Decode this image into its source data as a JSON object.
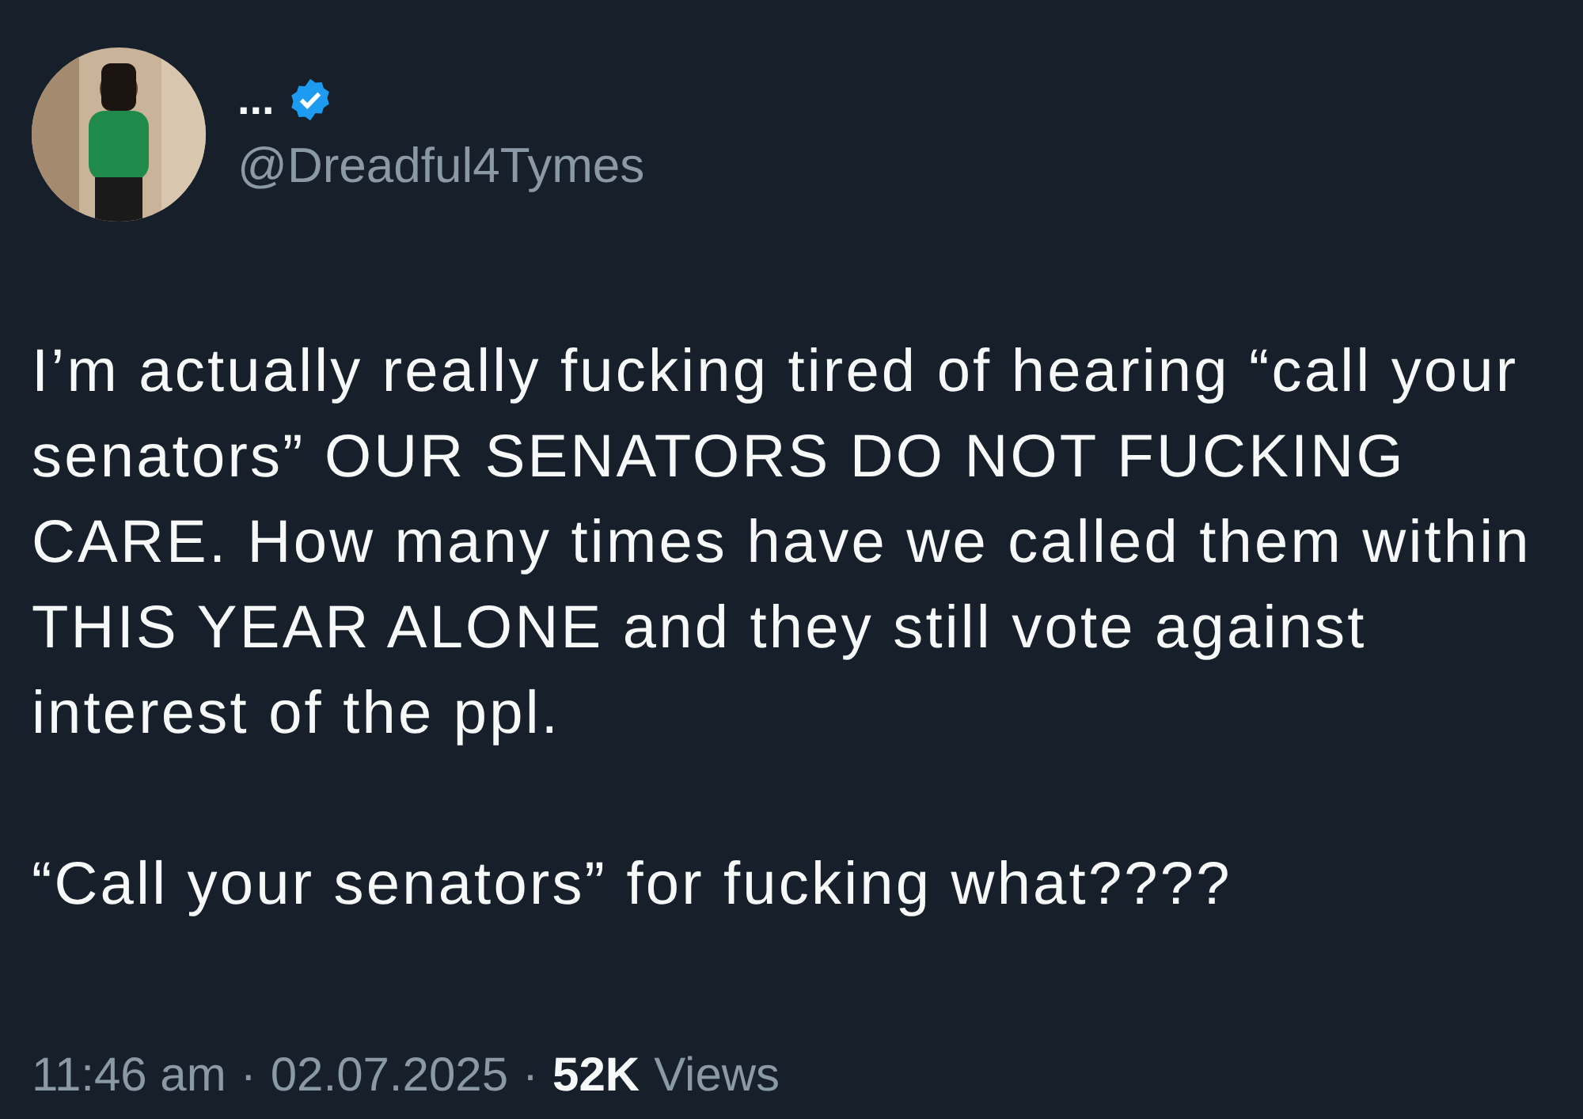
{
  "author": {
    "name": "...",
    "verified": true,
    "handle": "@Dreadful4Tymes"
  },
  "paragraphs": [
    "I’m actually really fucking tired of hearing “call your senators” OUR SENATORS DO NOT FUCKING CARE. How many times have we called them within THIS YEAR ALONE and they still vote against interest of the ppl.",
    "“Call your senators” for fucking what????"
  ],
  "meta": {
    "time": "11:46 am",
    "separator_1": "·",
    "date": "02.07.2025",
    "separator_2": "·",
    "views_count": "52K",
    "views_label": "Views"
  }
}
